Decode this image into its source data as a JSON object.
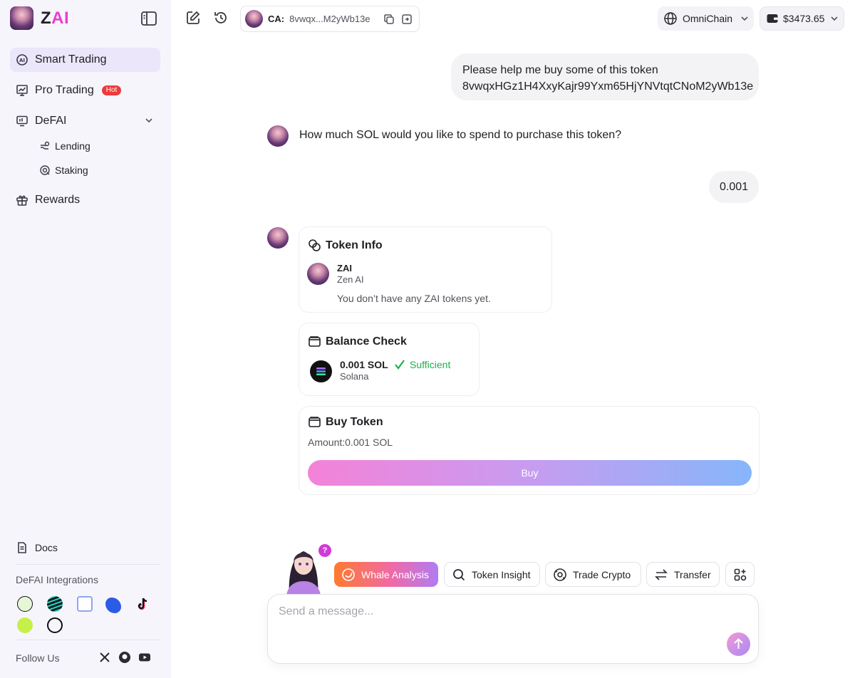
{
  "brand": {
    "name_prefix": "Z",
    "name_suffix": "AI"
  },
  "sidebar": {
    "nav": [
      {
        "label": "Smart Trading",
        "icon": "ai-chip-icon",
        "active": true
      },
      {
        "label": "Pro Trading",
        "icon": "chart-board-icon",
        "badge": "Hot"
      },
      {
        "label": "DeFAI",
        "icon": "monitor-icon",
        "expanded": true
      }
    ],
    "subnav": [
      {
        "label": "Lending",
        "icon": "lending-hand-icon"
      },
      {
        "label": "Staking",
        "icon": "staking-icon"
      }
    ],
    "rewards": {
      "label": "Rewards",
      "icon": "gift-icon"
    },
    "docs": {
      "label": "Docs",
      "icon": "document-icon"
    },
    "integrations_title": "DeFAI Integrations",
    "integrations": [
      "integration-1-icon",
      "integration-2-icon",
      "raydium-icon",
      "integration-4-icon",
      "tiktok-icon",
      "integration-6-icon",
      "integration-7-icon"
    ],
    "follow_label": "Follow Us",
    "socials": [
      "x-icon",
      "github-icon",
      "youtube-icon"
    ]
  },
  "topbar": {
    "ca_label": "CA:",
    "ca_value": "8vwqx...M2yWb13e",
    "network": "OmniChain",
    "wallet_balance": "$3473.65"
  },
  "chat": {
    "user_msg_1_line1": "Please help me buy some of this token",
    "user_msg_1_line2": "8vwqxHGz1H4XxyKajr99Yxm65HjYNVtqtCNoM2yWb13e",
    "bot_msg_1": "How much SOL would you like to spend to purchase this token?",
    "user_msg_2": "0.001"
  },
  "token_info": {
    "title": "Token Info",
    "symbol": "ZAI",
    "name": "Zen AI",
    "message": "You don’t have any ZAI tokens yet."
  },
  "balance_check": {
    "title": "Balance Check",
    "amount": "0.001 SOL",
    "chain": "Solana",
    "status": "Sufficient",
    "status_color": "#1bb24b"
  },
  "buy_token": {
    "title": "Buy Token",
    "amount_label": "Amount:0.001 SOL",
    "button_label": "Buy"
  },
  "quick_actions": [
    {
      "label": "Whale Analysis",
      "icon": "whale-icon"
    },
    {
      "label": "Token Insight",
      "icon": "search-icon"
    },
    {
      "label": "Trade Crypto",
      "icon": "trade-icon"
    },
    {
      "label": "Transfer",
      "icon": "transfer-icon"
    }
  ],
  "helper_badge": "?",
  "composer": {
    "placeholder": "Send a message..."
  },
  "colors": {
    "accent_pink": "#e83fd0",
    "hot_badge": "#ee3a3a",
    "active_nav_bg": "#ebe6f9"
  }
}
